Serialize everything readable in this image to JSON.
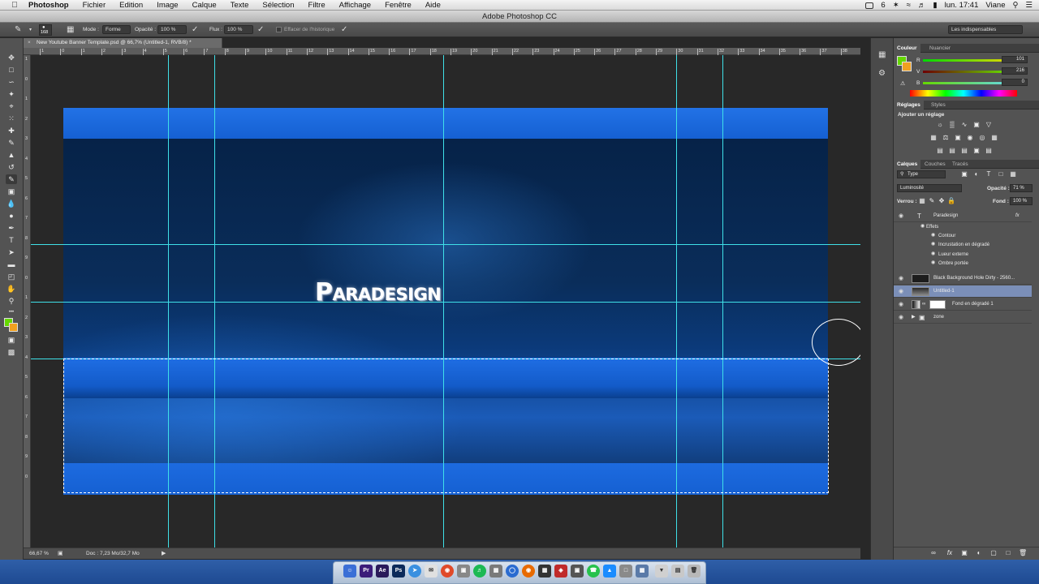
{
  "menubar": {
    "app_name": "Photoshop",
    "items": [
      "Fichier",
      "Edition",
      "Image",
      "Calque",
      "Texte",
      "Sélection",
      "Filtre",
      "Affichage",
      "Fenêtre",
      "Aide"
    ],
    "clock": "lun. 17:41",
    "user": "Viane",
    "tray_number": "6"
  },
  "window": {
    "title": "Adobe Photoshop CC"
  },
  "options": {
    "brush_size": "168",
    "mode_label": "Mode :",
    "mode_value": "Forme",
    "opacity_label": "Opacité :",
    "opacity_value": "100 %",
    "flux_label": "Flux :",
    "flux_value": "100 %",
    "history_label": "Effacer de l'historique",
    "workspace": "Les indispensables"
  },
  "document": {
    "tab_title": "New Youtube Banner Template.psd @ 66,7% (Untitled-1, RVB/8) *",
    "text": "Paradesign"
  },
  "ruler": {
    "h_ticks": [
      "1",
      "0",
      "1",
      "2",
      "3",
      "4",
      "5",
      "6",
      "7",
      "8",
      "9",
      "10",
      "11",
      "12",
      "13",
      "14",
      "15",
      "16",
      "17",
      "18",
      "19",
      "20",
      "21",
      "22",
      "23",
      "24",
      "25",
      "26",
      "27",
      "28",
      "29",
      "30",
      "31",
      "32",
      "33",
      "34",
      "35",
      "36",
      "37",
      "38"
    ],
    "v_ticks": [
      "1",
      "0",
      "1",
      "2",
      "3",
      "4",
      "5",
      "6",
      "7",
      "8",
      "9",
      "0",
      "1",
      "2",
      "3",
      "4",
      "5",
      "6",
      "7",
      "8",
      "9",
      "0"
    ]
  },
  "status": {
    "zoom": "66,67 %",
    "doc": "Doc : 7,23 Mo/32,7 Mo"
  },
  "color_panel": {
    "tabs": [
      "Couleur",
      "Nuancier"
    ],
    "r_label": "R",
    "v_label": "V",
    "b_label": "B",
    "r": "101",
    "v": "216",
    "b": "0",
    "foreground": "#65d800",
    "background": "#f0a020"
  },
  "adjust_panel": {
    "tabs": [
      "Réglages",
      "Styles"
    ],
    "heading": "Ajouter un réglage"
  },
  "layers_panel": {
    "tabs": [
      "Calques",
      "Couches",
      "Tracés"
    ],
    "filter": "Type",
    "blend_mode": "Luminosité",
    "opacity_label": "Opacité :",
    "opacity": "71 %",
    "lock_label": "Verrou :",
    "fill_label": "Fond :",
    "fill": "100 %",
    "layers": [
      {
        "name": "Paradesign",
        "type": "text"
      },
      {
        "name": "Black Background Hole Dirty - 2560...",
        "type": "image"
      },
      {
        "name": "Untitled-1",
        "type": "image",
        "selected": true
      },
      {
        "name": "Fond en dégradé 1",
        "type": "fill"
      },
      {
        "name": "zone",
        "type": "group"
      }
    ],
    "effects_label": "Effets",
    "effects": [
      "Contour",
      "Incrustation en dégradé",
      "Lueur externe",
      "Ombre portée"
    ]
  },
  "colors": {
    "accent_guide": "#3fe0e8",
    "banner_blue": "#1a66dd"
  }
}
